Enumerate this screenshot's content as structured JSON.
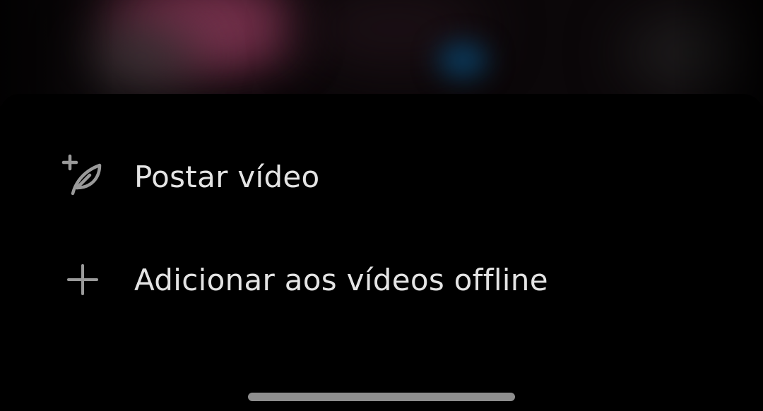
{
  "menu": {
    "items": [
      {
        "label": "Postar vídeo",
        "icon": "compose-feather-plus-icon"
      },
      {
        "label": "Adicionar aos vídeos offline",
        "icon": "plus-icon"
      }
    ]
  },
  "colors": {
    "background": "#000000",
    "text": "#e4e4e4",
    "icon": "#9a9a9a",
    "home_indicator": "#8e8e8e"
  }
}
